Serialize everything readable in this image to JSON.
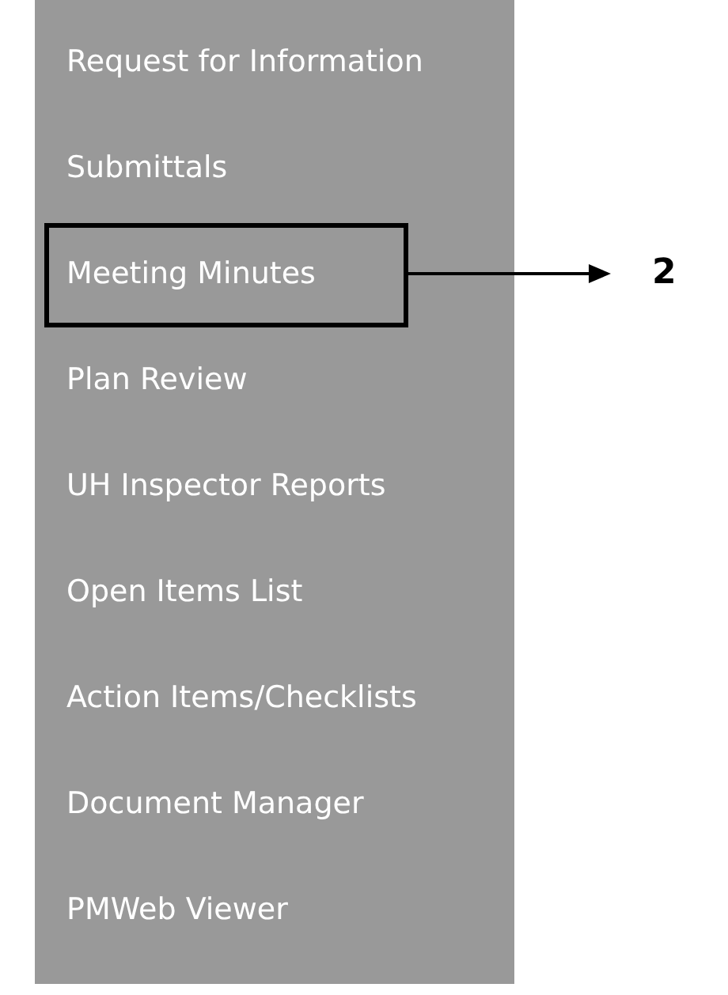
{
  "menu": {
    "items": [
      {
        "label": "Request for Information",
        "highlighted": false
      },
      {
        "label": "Submittals",
        "highlighted": false
      },
      {
        "label": "Meeting Minutes",
        "highlighted": true
      },
      {
        "label": "Plan Review",
        "highlighted": false
      },
      {
        "label": "UH Inspector Reports",
        "highlighted": false
      },
      {
        "label": "Open Items List",
        "highlighted": false
      },
      {
        "label": "Action Items/Checklists",
        "highlighted": false
      },
      {
        "label": "Document Manager",
        "highlighted": false
      },
      {
        "label": "PMWeb Viewer",
        "highlighted": false
      }
    ]
  },
  "callout": {
    "label": "2"
  }
}
